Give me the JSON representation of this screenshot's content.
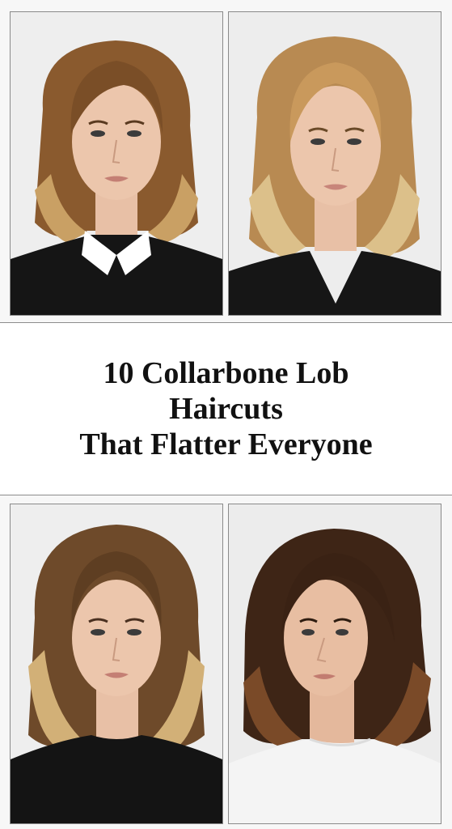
{
  "title": {
    "line1": "10 Collarbone Lob",
    "line2": "Haircuts",
    "line3": "That Flatter Everyone"
  },
  "photos": [
    {
      "hair_color": "#8a5a2e",
      "hair_tip": "#c9a064",
      "top": "#151515",
      "collar": "#ffffff"
    },
    {
      "hair_color": "#b88a52",
      "hair_tip": "#dcc08a",
      "top": "#161616"
    },
    {
      "hair_color": "#6e4a2a",
      "hair_tip": "#d2b077",
      "top": "#141414"
    },
    {
      "hair_color": "#3e2516",
      "hair_tip": "#7a4a28",
      "top": "#f4f4f4"
    }
  ],
  "colors": {
    "background": "#f7f7f7",
    "title_band": "#ffffff",
    "title_text": "#111111",
    "skin": "#e8c0a6"
  }
}
